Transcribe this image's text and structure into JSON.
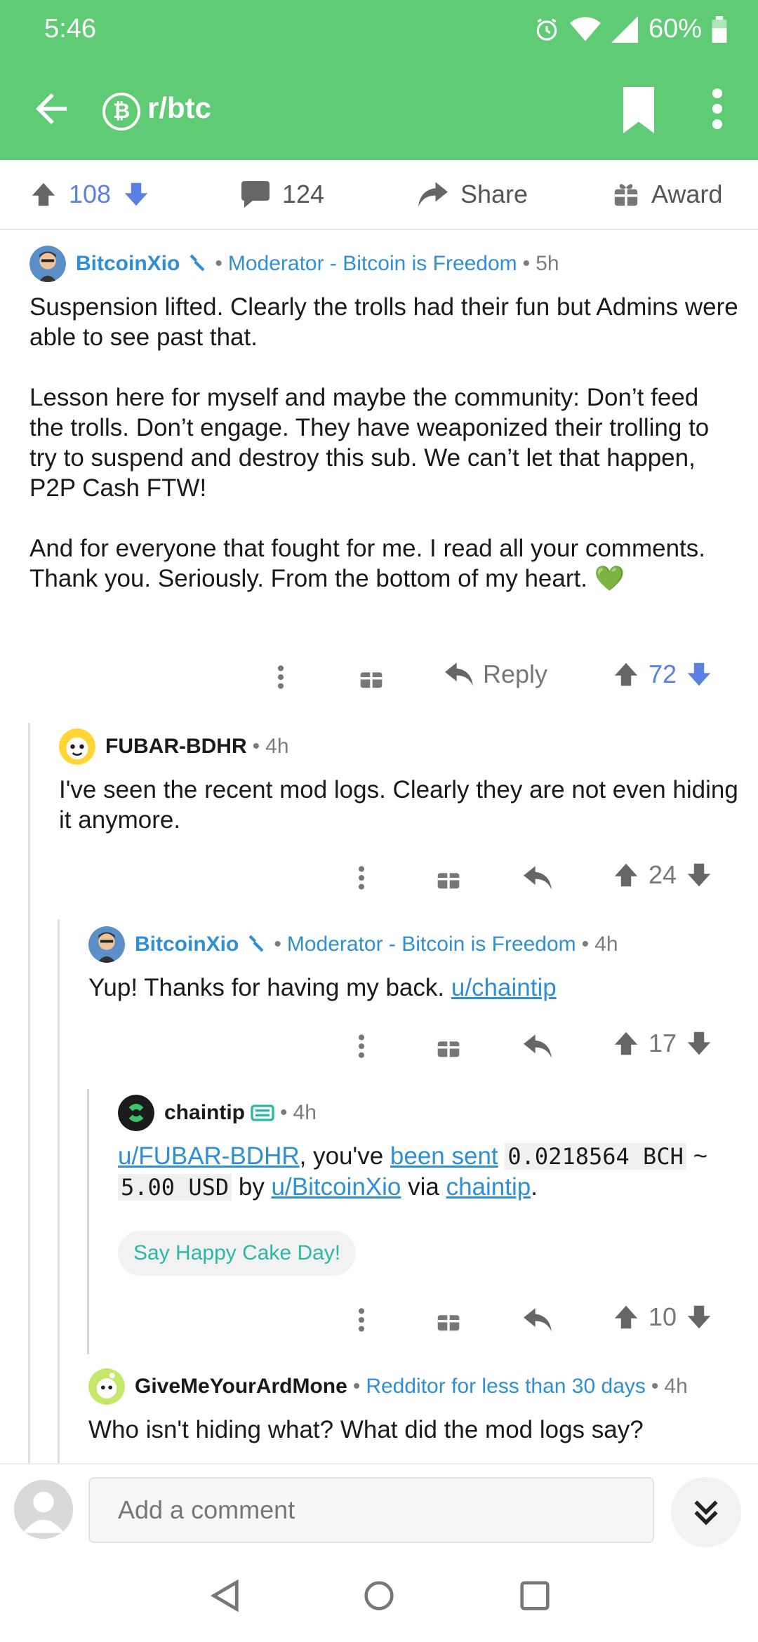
{
  "status_bar": {
    "time": "5:46",
    "battery": "60%"
  },
  "app_bar": {
    "subreddit": "r/btc",
    "sub_icon_glyph": "₿"
  },
  "post_actions": {
    "score": "108",
    "comments": "124",
    "share_label": "Share",
    "award_label": "Award"
  },
  "colors": {
    "header_green": "#5fcb74",
    "mod_blue": "#2f8fd4",
    "vote_blue": "#5b7fe3",
    "teal": "#2cb8a5",
    "heart_green": "#6ab04c"
  },
  "comments": [
    {
      "author": "BitcoinXio",
      "flair": "Moderator - Bitcoin is Freedom",
      "age": "5h",
      "paragraphs": [
        "Suspension lifted. Clearly the trolls had their fun but Admins were able to see past that.",
        "Lesson here for myself and maybe the community: Don’t feed the trolls. Don’t engage. They have weaponized their trolling to try to suspend and destroy this sub. We can’t let that happen, P2P Cash FTW!",
        "And for everyone that fought for me. I read all your comments. Thank you. Seriously. From the bottom of my heart. 💚"
      ],
      "reply_label": "Reply",
      "score": "72"
    },
    {
      "author": "FUBAR-BDHR",
      "age": "4h",
      "text": "I've seen the recent mod logs.  Clearly they are not even hiding it anymore.",
      "score": "24"
    },
    {
      "author": "BitcoinXio",
      "flair": "Moderator - Bitcoin is Freedom",
      "age": "4h",
      "text_prefix": "Yup! Thanks for having my back. ",
      "link": "u/chaintip",
      "score": "17"
    },
    {
      "author": "chaintip",
      "age": "4h",
      "link_user": "u/FUBAR-BDHR",
      "text_1": ", you've ",
      "link_sent": "been sent",
      "amount": "0.0218564 BCH",
      "sep": " ~ ",
      "usd": "5.00 USD",
      "text_by": " by ",
      "link_sender": "u/BitcoinXio",
      "text_via": " via ",
      "link_chaintip": "chaintip",
      "text_end": ".",
      "cake_label": "Say Happy Cake Day!",
      "score": "10"
    },
    {
      "author": "GiveMeYourArdMone",
      "flair": "Redditor for less than 30 days",
      "age": "4h",
      "text": "Who isn't hiding what? What did the mod logs say?"
    }
  ],
  "separator": "•",
  "comment_bar": {
    "placeholder": "Add a comment"
  }
}
